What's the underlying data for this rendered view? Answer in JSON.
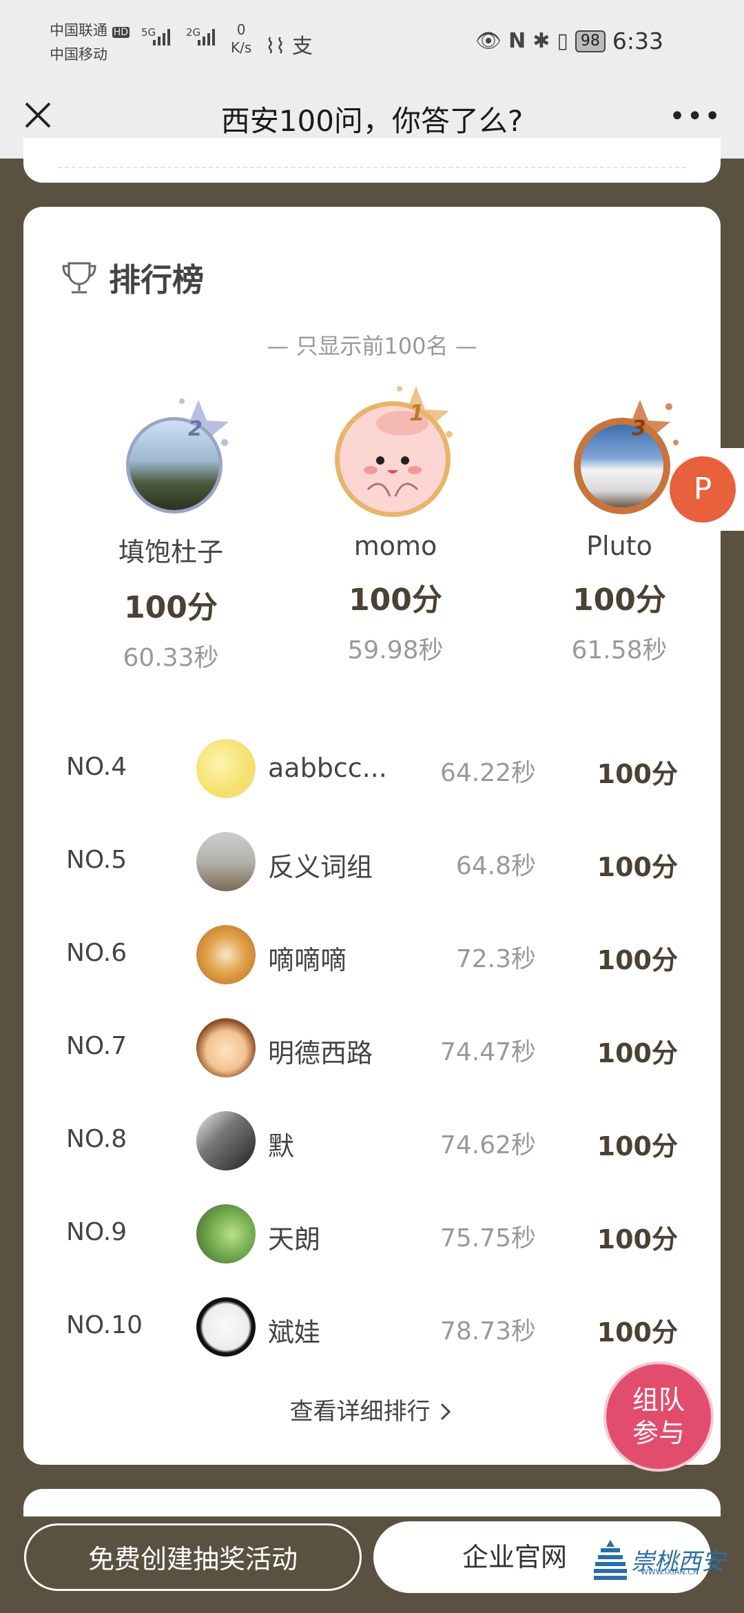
{
  "status_bar": {
    "carrier1": "中国联通",
    "carrier1_badge": "HD",
    "carrier2": "中国移动",
    "network1": "5G",
    "network2": "2G",
    "speed_value": "0",
    "speed_unit": "K/s",
    "battery": "98",
    "time": "6:33"
  },
  "nav": {
    "title": "西安100问，你答了么?"
  },
  "leaderboard": {
    "title": "排行榜",
    "subtitle": "— 只显示前100名 —",
    "podium": [
      {
        "rank": "2",
        "name": "填饱杜子",
        "score": "100分",
        "time": "60.33秒"
      },
      {
        "rank": "1",
        "name": "momo",
        "score": "100分",
        "time": "59.98秒"
      },
      {
        "rank": "3",
        "name": "Pluto",
        "score": "100分",
        "time": "61.58秒"
      }
    ],
    "rows": [
      {
        "rank": "NO.4",
        "name": "aabbcc...",
        "time": "64.22秒",
        "score": "100分"
      },
      {
        "rank": "NO.5",
        "name": "反义词组",
        "time": "64.8秒",
        "score": "100分"
      },
      {
        "rank": "NO.6",
        "name": "嘀嘀嘀",
        "time": "72.3秒",
        "score": "100分"
      },
      {
        "rank": "NO.7",
        "name": "明德西路",
        "time": "74.47秒",
        "score": "100分"
      },
      {
        "rank": "NO.8",
        "name": "默",
        "time": "74.62秒",
        "score": "100分"
      },
      {
        "rank": "NO.9",
        "name": "天朗",
        "time": "75.75秒",
        "score": "100分"
      },
      {
        "rank": "NO.10",
        "name": "斌娃",
        "time": "78.73秒",
        "score": "100分"
      }
    ],
    "detail_link": "查看详细排行"
  },
  "floating": {
    "p_label": "P",
    "team_line1": "组队",
    "team_line2": "参与"
  },
  "bottom": {
    "create_button": "免费创建抽奖活动",
    "official_button": "企业官网",
    "watermark": "崇桃西安",
    "watermark_url": "WWW.IXIAN.CN"
  },
  "colors": {
    "background": "#5a5140",
    "gold": "#e8b46a",
    "silver": "#9aa3c8",
    "bronze": "#c8743c",
    "accent": "#e24d6e"
  }
}
